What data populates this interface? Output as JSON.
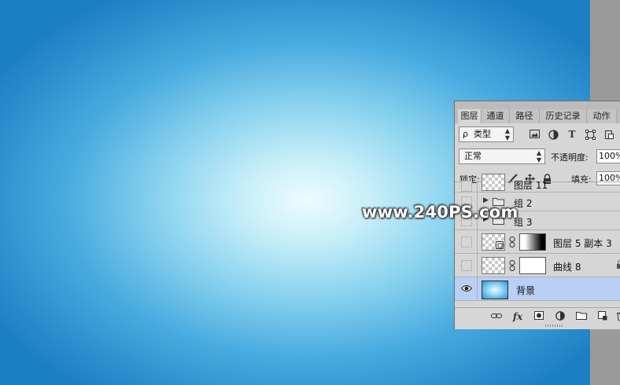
{
  "watermark": "www.240PS.com",
  "colors": {
    "accent_selected": "#b9cff5",
    "panel_bg": "#d6d6d6",
    "canvas_center": "#eefcff",
    "canvas_edge": "#1b7fc3"
  },
  "tabs": [
    {
      "label": "图层",
      "active": true
    },
    {
      "label": "通道",
      "active": false
    },
    {
      "label": "路径",
      "active": false
    },
    {
      "label": "历史记录",
      "active": false
    },
    {
      "label": "动作",
      "active": false
    }
  ],
  "filter": {
    "search_glyph": "ρ",
    "kind_label": "类型"
  },
  "blend": {
    "mode": "正常",
    "opacity_label": "不透明度:",
    "opacity_value": "100%"
  },
  "lock": {
    "label": "锁定:",
    "fill_label": "填充:",
    "fill_value": "100%"
  },
  "layers": [
    {
      "name": "图层 11",
      "type": "pixel",
      "visible": false
    },
    {
      "name": "组 2",
      "type": "group",
      "visible": false
    },
    {
      "name": "组 3",
      "type": "group",
      "visible": false
    },
    {
      "name": "图层 5 副本 3",
      "type": "smart-with-mask",
      "visible": false
    },
    {
      "name": "曲线 8",
      "type": "adjustment-with-mask",
      "visible": false
    },
    {
      "name": "背景",
      "type": "background",
      "visible": true,
      "selected": true
    }
  ],
  "bottom_icons": [
    "link-icon",
    "fx-icon",
    "mask-icon",
    "adjustment-icon",
    "folder-icon",
    "new-layer-icon",
    "trash-icon"
  ],
  "fx_label": "fx"
}
